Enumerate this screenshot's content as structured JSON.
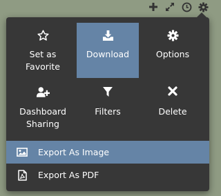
{
  "toolbar": {
    "icons": [
      "plus-icon",
      "expand-icon",
      "clock-icon",
      "gear-icon"
    ]
  },
  "menu": {
    "tiles": [
      {
        "label": "Set as Favorite",
        "icon": "star-outline-icon"
      },
      {
        "label": "Download",
        "icon": "download-icon",
        "active": true
      },
      {
        "label": "Options",
        "icon": "gear-icon"
      },
      {
        "label": "Dashboard Sharing",
        "icon": "user-plus-icon"
      },
      {
        "label": "Filters",
        "icon": "filter-icon"
      },
      {
        "label": "Delete",
        "icon": "close-x-icon"
      }
    ],
    "sub_items": [
      {
        "label": "Export As Image",
        "icon": "image-icon",
        "highlighted": true
      },
      {
        "label": "Export As PDF",
        "icon": "pdf-file-icon"
      }
    ]
  },
  "colors": {
    "background": "#8f9b83",
    "menu": "#373737",
    "accent": "#6584a6",
    "text": "#ffffff"
  }
}
